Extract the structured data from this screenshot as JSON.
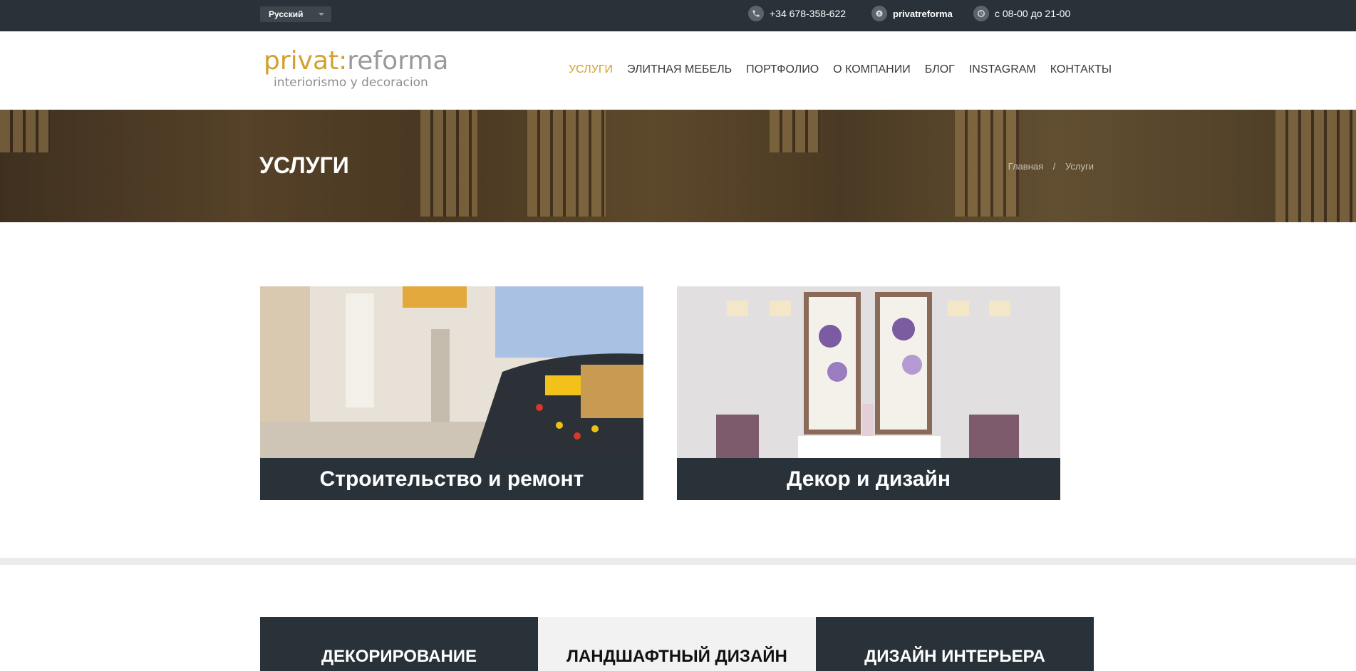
{
  "topbar": {
    "language": "Русский",
    "phone": "+34 678-358-622",
    "skype": "privatreforma",
    "hours": "с 08-00 до 21-00"
  },
  "logo": {
    "part1": "privat:",
    "part2": "reforma",
    "tagline": "interiorismo y decoracion"
  },
  "nav": {
    "items": [
      {
        "label": "УСЛУГИ"
      },
      {
        "label": "ЭЛИТНАЯ МЕБЕЛЬ"
      },
      {
        "label": "ПОРТФОЛИО"
      },
      {
        "label": "О КОМПАНИИ"
      },
      {
        "label": "БЛОГ"
      },
      {
        "label": "INSTAGRAM"
      },
      {
        "label": "КОНТАКТЫ"
      }
    ],
    "active_color": "#d2a12c"
  },
  "banner": {
    "title": "УСЛУГИ",
    "breadcrumb": [
      {
        "label": "Главная"
      },
      {
        "label": "Услуги"
      }
    ],
    "separator": "/"
  },
  "services": [
    {
      "label": "Строительство и ремонт"
    },
    {
      "label": "Декор и дизайн"
    }
  ],
  "tiles": [
    {
      "label": "ДЕКОРИРОВАНИЕ"
    },
    {
      "label": "ЛАНДШАФТНЫЙ ДИЗАЙН"
    },
    {
      "label": "ДИЗАЙН ИНТЕРЬЕРА"
    }
  ],
  "colors": {
    "dark": "#283238",
    "accent": "#d2a12c"
  }
}
